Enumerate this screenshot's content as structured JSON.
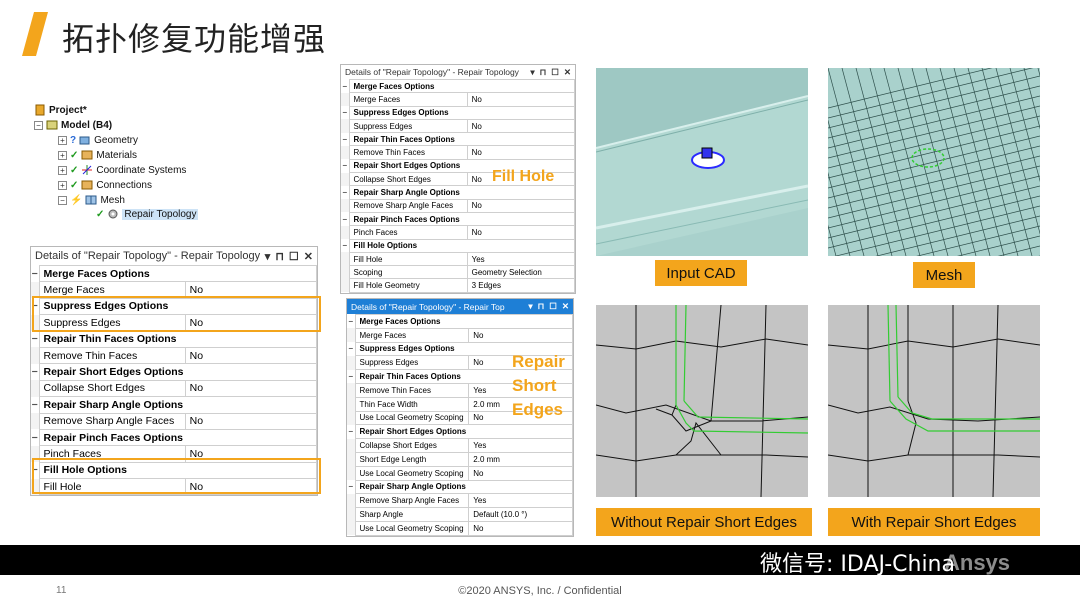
{
  "title": "拓扑修复功能增强",
  "tree": {
    "project": "Project*",
    "model": "Model (B4)",
    "geometry": "Geometry",
    "materials": "Materials",
    "coordinate_systems": "Coordinate Systems",
    "connections": "Connections",
    "mesh": "Mesh",
    "repair_topology": "Repair Topology"
  },
  "panel_left": {
    "header": "Details of \"Repair Topology\" - Repair Topology",
    "controls": [
      "▾",
      "⊓",
      "☐",
      "✕"
    ],
    "rows": [
      {
        "group": true,
        "label": "Merge Faces Options"
      },
      {
        "label": "Merge Faces",
        "value": "No"
      },
      {
        "group": true,
        "label": "Suppress Edges Options"
      },
      {
        "label": "Suppress Edges",
        "value": "No"
      },
      {
        "group": true,
        "label": "Repair Thin Faces Options"
      },
      {
        "label": "Remove Thin Faces",
        "value": "No"
      },
      {
        "group": true,
        "label": "Repair Short Edges Options"
      },
      {
        "label": "Collapse Short Edges",
        "value": "No"
      },
      {
        "group": true,
        "label": "Repair Sharp Angle Options"
      },
      {
        "label": "Remove Sharp Angle Faces",
        "value": "No"
      },
      {
        "group": true,
        "label": "Repair Pinch Faces Options"
      },
      {
        "label": "Pinch Faces",
        "value": "No"
      },
      {
        "group": true,
        "label": "Fill Hole Options"
      },
      {
        "label": "Fill Hole",
        "value": "No"
      }
    ]
  },
  "panel_fill": {
    "header": "Details of \"Repair Topology\" - Repair Topology",
    "controls": [
      "▾",
      "⊓",
      "☐",
      "✕"
    ],
    "rows": [
      {
        "group": true,
        "label": "Merge Faces Options"
      },
      {
        "label": "Merge Faces",
        "value": "No"
      },
      {
        "group": true,
        "label": "Suppress Edges Options"
      },
      {
        "label": "Suppress Edges",
        "value": "No"
      },
      {
        "group": true,
        "label": "Repair Thin Faces Options"
      },
      {
        "label": "Remove Thin Faces",
        "value": "No"
      },
      {
        "group": true,
        "label": "Repair Short Edges Options"
      },
      {
        "label": "Collapse Short Edges",
        "value": "No"
      },
      {
        "group": true,
        "label": "Repair Sharp Angle Options"
      },
      {
        "label": "Remove Sharp Angle Faces",
        "value": "No"
      },
      {
        "group": true,
        "label": "Repair Pinch Faces Options"
      },
      {
        "label": "Pinch Faces",
        "value": "No"
      },
      {
        "group": true,
        "label": "Fill Hole Options"
      },
      {
        "label": "Fill Hole",
        "value": "Yes"
      },
      {
        "label": "Scoping",
        "value": "Geometry Selection"
      },
      {
        "label": "Fill Hole Geometry",
        "value": "3 Edges"
      }
    ],
    "callout": "Fill Hole"
  },
  "panel_short": {
    "header": "Details of \"Repair Topology\" - Repair Top",
    "controls": [
      "▾",
      "⊓",
      "☐",
      "✕"
    ],
    "rows": [
      {
        "group": true,
        "label": "Merge Faces Options"
      },
      {
        "label": "Merge Faces",
        "value": "No"
      },
      {
        "group": true,
        "label": "Suppress Edges Options"
      },
      {
        "label": "Suppress Edges",
        "value": "No"
      },
      {
        "group": true,
        "label": "Repair Thin Faces Options"
      },
      {
        "label": "Remove Thin Faces",
        "value": "Yes"
      },
      {
        "label": "Thin Face Width",
        "value": "2.0 mm"
      },
      {
        "label": "Use Local Geometry Scoping",
        "value": "No"
      },
      {
        "group": true,
        "label": "Repair Short Edges Options"
      },
      {
        "label": "Collapse Short Edges",
        "value": "Yes"
      },
      {
        "label": "Short Edge Length",
        "value": "2.0 mm"
      },
      {
        "label": "Use Local Geometry Scoping",
        "value": "No"
      },
      {
        "group": true,
        "label": "Repair Sharp Angle Options"
      },
      {
        "label": "Remove Sharp Angle Faces",
        "value": "Yes"
      },
      {
        "label": "Sharp Angle",
        "value": "Default (10.0 °)"
      },
      {
        "label": "Use Local Geometry Scoping",
        "value": "No"
      }
    ],
    "callout_lines": [
      "Repair",
      "Short",
      "Edges"
    ]
  },
  "captions": {
    "input_cad": "Input CAD",
    "mesh": "Mesh",
    "without": "Without Repair Short Edges",
    "with": "With Repair Short Edges"
  },
  "footer": {
    "page": "11",
    "copyright": "©2020 ANSYS, Inc. / Confidential",
    "watermark": "微信号: IDAJ-China",
    "brand": "Ansys"
  },
  "colors": {
    "accent": "#f3a51c",
    "cad_surface": "#a9d1cc",
    "mesh_green": "#33cc33",
    "panel_blue": "#1e7fd6"
  }
}
